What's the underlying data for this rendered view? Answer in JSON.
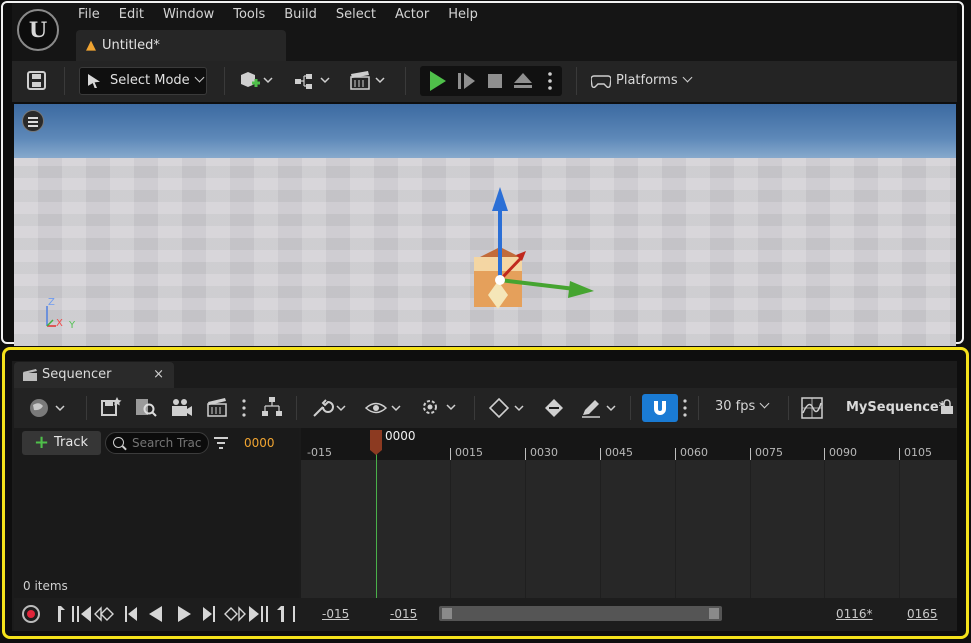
{
  "menu": [
    "File",
    "Edit",
    "Window",
    "Tools",
    "Build",
    "Select",
    "Actor",
    "Help"
  ],
  "logo_text": "U",
  "document_tab": "Untitled*",
  "toolbar": {
    "select_mode_label": "Select Mode",
    "platforms_label": "Platforms"
  },
  "viewport": {
    "axis_labels": {
      "z": "Z",
      "x": "X",
      "y": "Y"
    }
  },
  "sequencer": {
    "tab_label": "Sequencer",
    "close_glyph": "×",
    "fps_label": "30 fps",
    "sequence_name": "MySequence*",
    "track_button_label": "Track",
    "search_placeholder": "Search Trac",
    "current_time": "0000",
    "items_count": "0 items",
    "playhead_label": "0000",
    "ruler_labels": [
      "-015",
      "0015",
      "0030",
      "0045",
      "0060",
      "0075",
      "0090",
      "0105"
    ],
    "bottom": {
      "view_start": "-015",
      "working_start": "-015",
      "working_end": "0116*",
      "view_end": "0165"
    }
  },
  "colors": {
    "highlight": "#f5e21b",
    "accent_blue": "#1a7bd4",
    "play_green": "#4fc04a",
    "orange": "#f0a431",
    "record_red": "#e0253a"
  }
}
